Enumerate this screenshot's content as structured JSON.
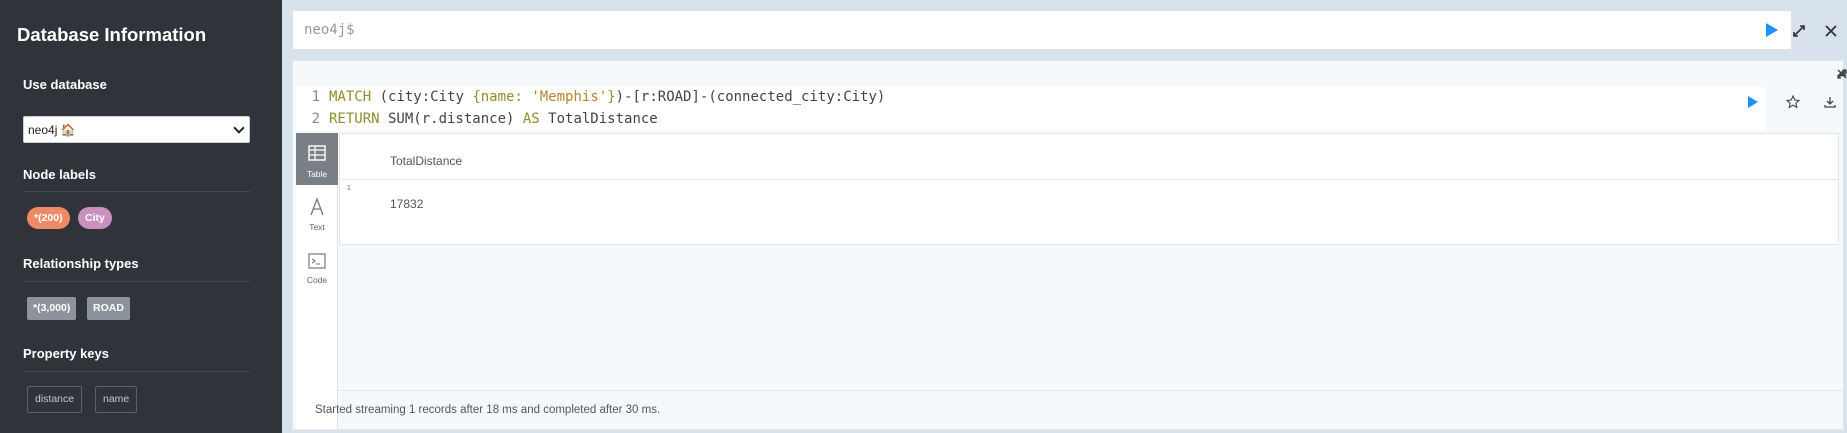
{
  "sidebar": {
    "title": "Database Information",
    "use_database_heading": "Use database",
    "database_selected": "neo4j 🏠",
    "node_labels_heading": "Node labels",
    "node_labels": [
      "*(200)",
      "City"
    ],
    "relationship_types_heading": "Relationship types",
    "relationship_types": [
      "*(3,000)",
      "ROAD"
    ],
    "property_keys_heading": "Property keys",
    "property_keys": [
      "distance",
      "name"
    ]
  },
  "editor": {
    "prompt": "neo4j$"
  },
  "query": {
    "line1_num": "1",
    "line2_num": "2",
    "line1": {
      "match": "MATCH",
      "t1": " (city:City ",
      "brace_open": "{",
      "prop": "name: ",
      "str": "'Memphis'",
      "brace_close": "}",
      "t2": ")-[r:ROAD]-(connected_city:City)"
    },
    "line2": {
      "return": "RETURN",
      "t1": " SUM(r.distance) ",
      "as": "AS",
      "t2": " TotalDistance"
    }
  },
  "views": {
    "table": "Table",
    "text": "Text",
    "code": "Code"
  },
  "result": {
    "column": "TotalDistance",
    "row_number": "1",
    "value": "17832"
  },
  "status": "Started streaming 1 records after 18 ms and completed after 30 ms.",
  "colors": {
    "sidebar_bg": "#30333a",
    "node_all": "#ee8a66",
    "node_city": "#c990c0",
    "rel_tag": "#8d939c",
    "run_blue": "#1e90ff"
  }
}
